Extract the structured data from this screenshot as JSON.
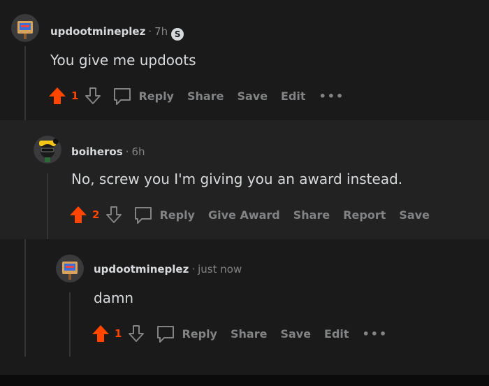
{
  "comments": [
    {
      "username": "updootmineplez",
      "time": "7h",
      "badge": "S",
      "body": "You give me updoots",
      "votes": "1",
      "actions": [
        "Reply",
        "Share",
        "Save",
        "Edit"
      ],
      "more": "•••"
    },
    {
      "username": "boiheros",
      "time": "6h",
      "body": "No, screw you I'm giving you an award instead.",
      "votes": "2",
      "actions": [
        "Reply",
        "Give Award",
        "Share",
        "Report",
        "Save"
      ]
    },
    {
      "username": "updootmineplez",
      "time": "just now",
      "body": "damn",
      "votes": "1",
      "actions": [
        "Reply",
        "Share",
        "Save",
        "Edit"
      ],
      "more": "•••"
    }
  ],
  "colors": {
    "upvote": "#ff4500",
    "muted": "#818384",
    "text": "#d7dadc",
    "bg": "#1a1a1b",
    "bg_nested": "#222223"
  }
}
